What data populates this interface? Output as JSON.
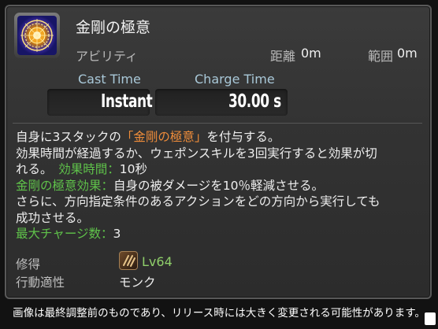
{
  "skill": {
    "name": "金剛の極意",
    "type": "アビリティ",
    "icon": "golden-mandala-icon",
    "range_label": "距離",
    "range_value": "0m",
    "radius_label": "範囲",
    "radius_value": "0m"
  },
  "timing": {
    "cast_label": "Cast Time",
    "cast_value": "Instant",
    "charge_label": "Charge Time",
    "charge_value": "30.00 s"
  },
  "description": {
    "line1_pre": "自身に3スタックの",
    "line1_highlight": "「金剛の極意」",
    "line1_post": "を付与する。",
    "line2": "効果時間が経過するか、ウェポンスキルを3回実行すると効果が切",
    "line3_pre": "れる。",
    "duration_label": "効果時間：",
    "duration_value": "10秒",
    "effect_label": "金剛の極意効果：",
    "effect_text": "自身の被ダメージを10％軽減させる。",
    "line5": "さらに、方向指定条件のあるアクションをどの方向から実行しても",
    "line6": "成功させる。",
    "max_charges_label": "最大チャージ数：",
    "max_charges_value": "3"
  },
  "acquisition": {
    "label": "修得",
    "class_icon": "monk-class-icon",
    "level": "Lv64"
  },
  "affinity": {
    "label": "行動適性",
    "value": "モンク"
  },
  "footer": {
    "note": "画像は最終調整前のものであり、リリース時には大きく変更される可能性があります。"
  },
  "colors": {
    "highlight_orange": "#ee8c3a",
    "label_green": "#5fc24a",
    "level_green": "#8fcf6a",
    "time_label_blue": "#a9c8d8"
  }
}
